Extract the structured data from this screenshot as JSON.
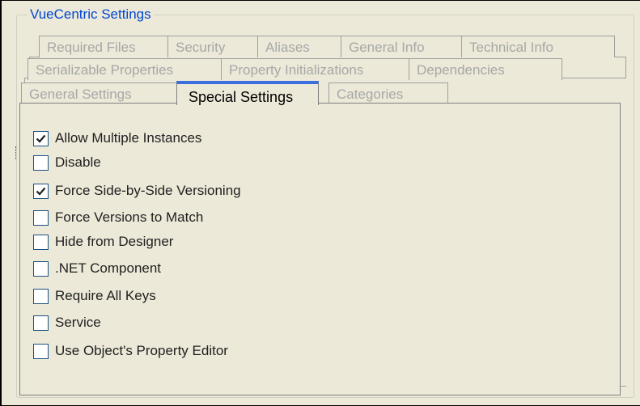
{
  "window": {
    "title": "VueCentric Settings"
  },
  "tabs": {
    "row1": [
      "Required Files",
      "Security",
      "Aliases",
      "General Info",
      "Technical Info"
    ],
    "row2": [
      "Serializable Properties",
      "Property Initializations",
      "Dependencies"
    ],
    "row3": [
      "General Settings",
      "Special Settings",
      "Categories"
    ],
    "active": "Special Settings"
  },
  "options": [
    {
      "label": "Allow Multiple Instances",
      "checked": true
    },
    {
      "label": "Disable",
      "checked": false
    },
    {
      "label": "Force Side-by-Side Versioning",
      "checked": true
    },
    {
      "label": "Force Versions to Match",
      "checked": false
    },
    {
      "label": "Hide from Designer",
      "checked": false
    },
    {
      "label": ".NET Component",
      "checked": false
    },
    {
      "label": "Require All Keys",
      "checked": false
    },
    {
      "label": "Service",
      "checked": false
    },
    {
      "label": "Use Object's Property Editor",
      "checked": false
    }
  ],
  "colors": {
    "accent": "#3c6ee0",
    "title": "#0046d5",
    "background": "#ece9d8"
  }
}
